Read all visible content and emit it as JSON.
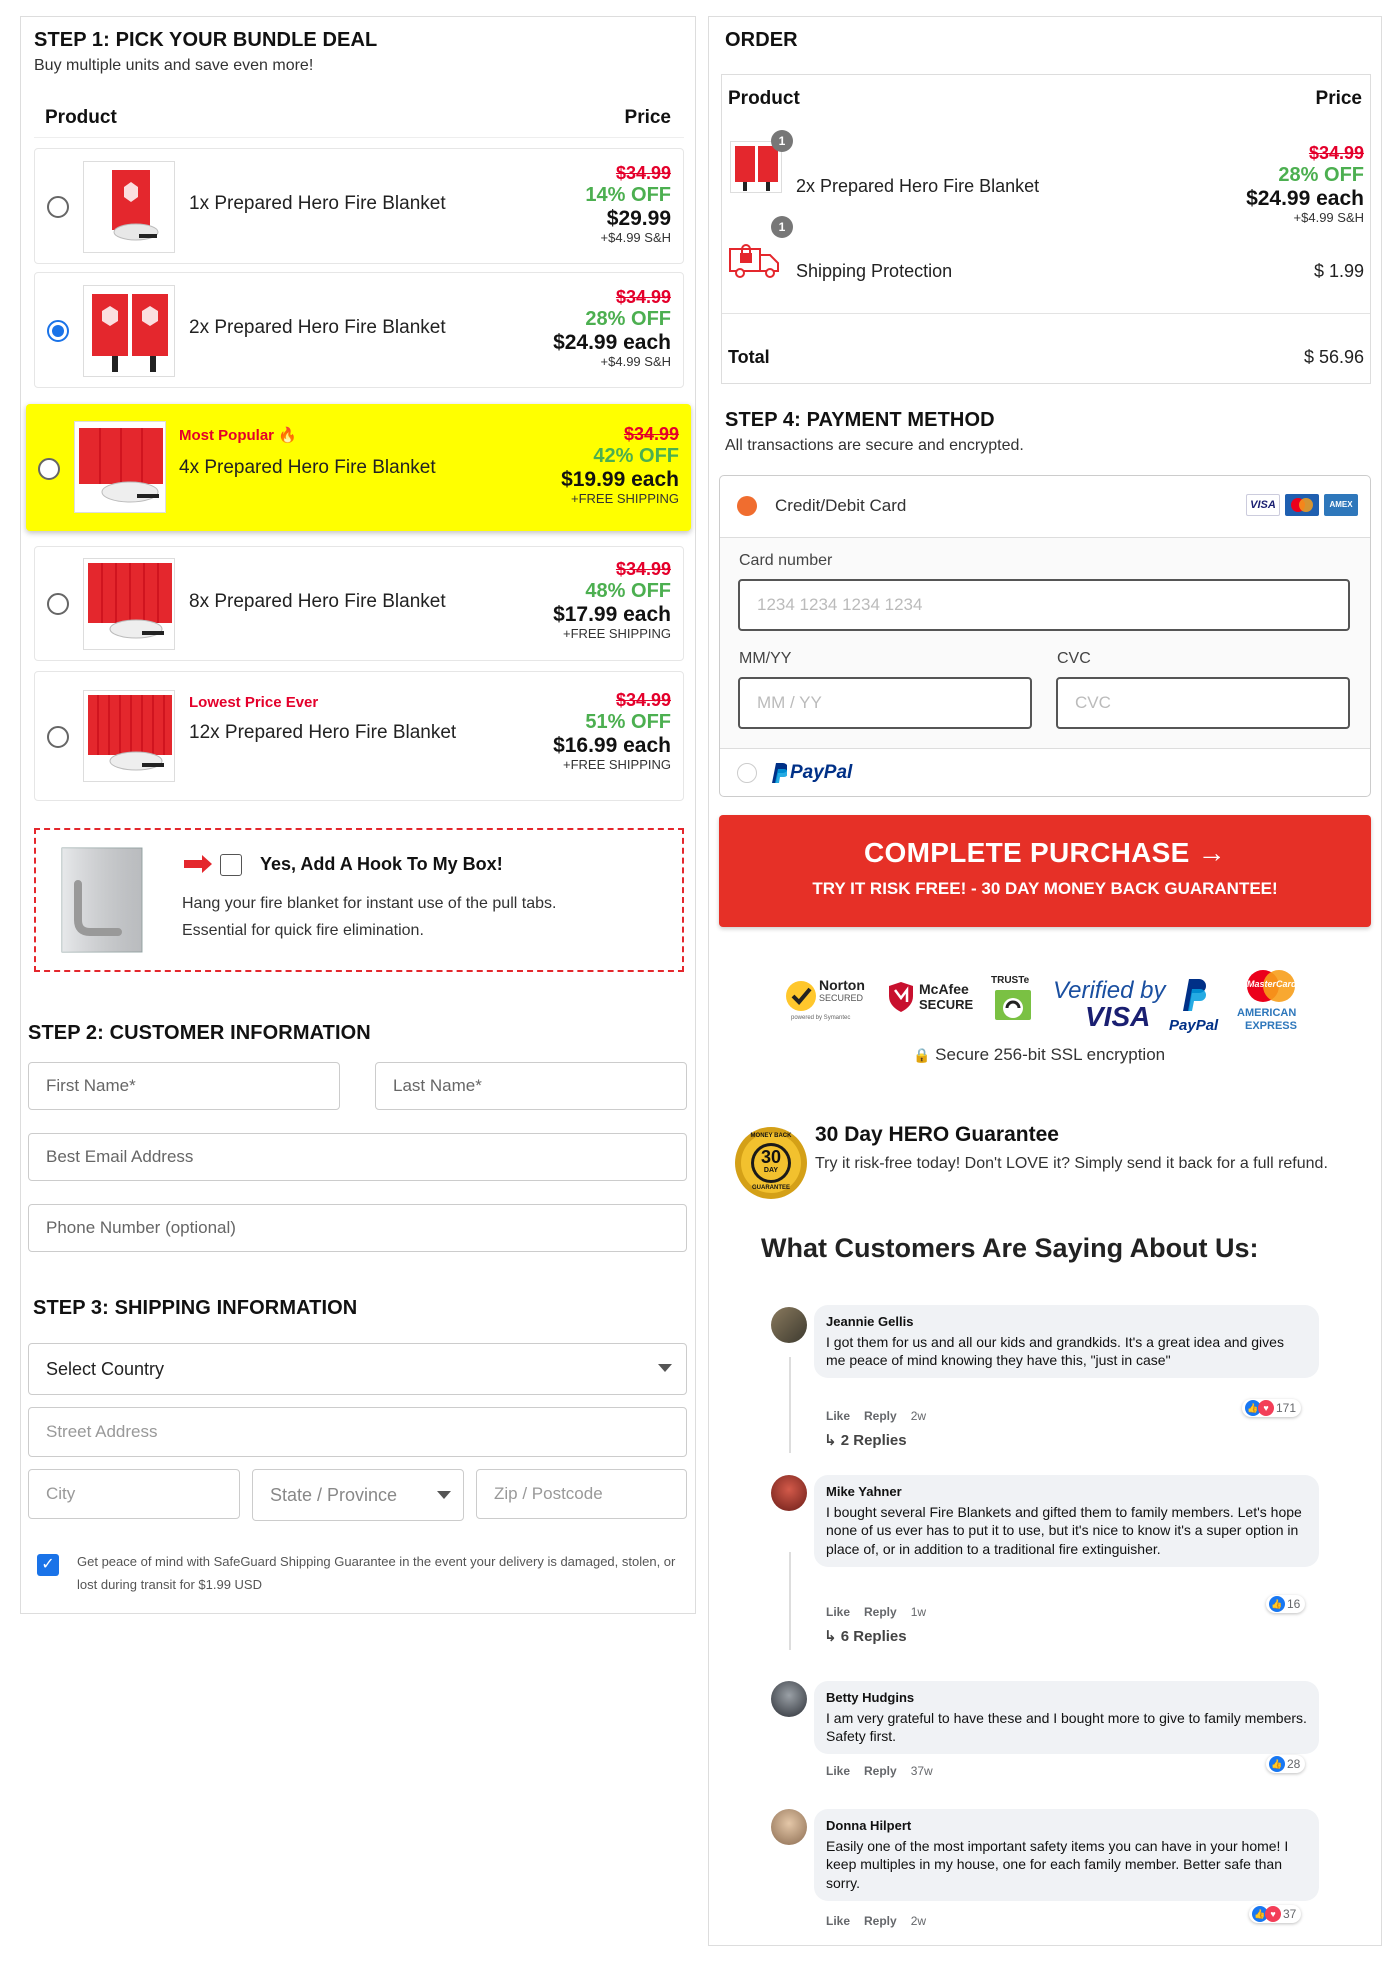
{
  "step1": {
    "title": "STEP 1: PICK YOUR BUNDLE DEAL",
    "subtitle": "Buy multiple units and save even more!",
    "col_product": "Product",
    "col_price": "Price",
    "bundles": [
      {
        "name": "1x Prepared Hero Fire Blanket",
        "old": "$34.99",
        "off": "14% OFF",
        "price": "$29.99",
        "ship": "+$4.99 S&H",
        "tag": "",
        "selected": false
      },
      {
        "name": "2x Prepared Hero Fire Blanket",
        "old": "$34.99",
        "off": "28% OFF",
        "price": "$24.99 each",
        "ship": "+$4.99 S&H",
        "tag": "",
        "selected": true
      },
      {
        "name": "4x Prepared Hero Fire Blanket",
        "old": "$34.99",
        "off": "42% OFF",
        "price": "$19.99 each",
        "ship": "+FREE SHIPPING",
        "tag": "Most Popular 🔥",
        "selected": false
      },
      {
        "name": "8x Prepared Hero Fire Blanket",
        "old": "$34.99",
        "off": "48% OFF",
        "price": "$17.99 each",
        "ship": "+FREE SHIPPING",
        "tag": "",
        "selected": false
      },
      {
        "name": "12x Prepared Hero Fire Blanket",
        "old": "$34.99",
        "off": "51% OFF",
        "price": "$16.99 each",
        "ship": "+FREE SHIPPING",
        "tag": "Lowest Price Ever",
        "selected": false
      }
    ],
    "upsell": {
      "label": "Yes, Add A Hook To My Box!",
      "desc1": "Hang your fire blanket for instant use of the pull tabs.",
      "desc2": "Essential for quick fire elimination."
    }
  },
  "step2": {
    "title": "STEP 2: CUSTOMER INFORMATION",
    "first_name": "First Name*",
    "last_name": "Last Name*",
    "email": "Best Email Address",
    "phone": "Phone Number (optional)"
  },
  "step3": {
    "title": "STEP 3: SHIPPING INFORMATION",
    "country": "Select Country",
    "street": "Street Address",
    "city": "City",
    "state": "State / Province",
    "zip": "Zip / Postcode",
    "safeguard": "Get peace of mind with SafeGuard Shipping Guarantee in the event your delivery is damaged, stolen, or lost during transit for $1.99 USD"
  },
  "order": {
    "title": "ORDER",
    "col_product": "Product",
    "col_price": "Price",
    "items": [
      {
        "qty": "1",
        "name": "2x Prepared Hero Fire Blanket",
        "old": "$34.99",
        "off": "28% OFF",
        "price": "$24.99 each",
        "ship": "+$4.99 S&H"
      },
      {
        "qty": "1",
        "name": "Shipping Protection",
        "price": "$ 1.99"
      }
    ],
    "total_label": "Total",
    "total": "$ 56.96"
  },
  "step4": {
    "title": "STEP 4: PAYMENT METHOD",
    "subtitle": "All transactions are secure and encrypted.",
    "card_label": "Credit/Debit Card",
    "card_number_label": "Card number",
    "card_number_ph": "1234 1234 1234 1234",
    "exp_label": "MM/YY",
    "exp_ph": "MM / YY",
    "cvc_label": "CVC",
    "cvc_ph": "CVC",
    "paypal": "PayPal",
    "visa": "VISA",
    "amex": "AMEX"
  },
  "purchase": {
    "main": "COMPLETE PURCHASE →",
    "sub": "TRY IT RISK FREE! - 30 DAY MONEY BACK GUARANTEE!"
  },
  "trust": {
    "norton": "Norton",
    "norton_sub": "SECURED",
    "norton_powered": "powered by Symantec",
    "mcafee": "McAfee",
    "mcafee_sub": "SECURE",
    "truste": "TRUSTe",
    "verified_by": "Verified by",
    "visa": "VISA",
    "paypal": "PayPal",
    "mastercard": "MasterCard",
    "amex1": "AMERICAN",
    "amex2": "EXPRESS",
    "ssl": "Secure 256-bit SSL encryption"
  },
  "guarantee": {
    "badge_num": "30",
    "badge_top": "MONEY BACK",
    "badge_day": "DAY",
    "badge_bottom": "GUARANTEE",
    "title": "30 Day HERO Guarantee",
    "text": "Try it risk-free today! Don't LOVE it? Simply send it back for a full refund."
  },
  "reviews": {
    "title": "What Customers Are Saying About Us:",
    "like": "Like",
    "reply": "Reply",
    "items": [
      {
        "name": "Jeannie Gellis",
        "text": "I got them for us and all our kids and grandkids. It's a great idea and gives me peace of mind knowing they have this, \"just in case\"",
        "time": "2w",
        "count": "171",
        "replies": "2 Replies"
      },
      {
        "name": "Mike Yahner",
        "text": "I bought several Fire Blankets and gifted them to family members. Let's hope none of us ever has to put it to use, but it's nice to know it's a super option in place of, or in addition to a traditional fire extinguisher.",
        "time": "1w",
        "count": "16",
        "replies": "6 Replies"
      },
      {
        "name": "Betty Hudgins",
        "text": "I am very grateful to have these and I bought more to give to family members. Safety first.",
        "time": "37w",
        "count": "28"
      },
      {
        "name": "Donna Hilpert",
        "text": "Easily one of the most important safety items you can have in your home! I keep multiples in my house, one for each family member. Better safe than sorry.",
        "time": "2w",
        "count": "37"
      }
    ]
  },
  "colors": {
    "accent_red": "#e63027",
    "off_green": "#4caf50",
    "highlight": "#ffff00",
    "link_blue": "#1a73e8"
  }
}
